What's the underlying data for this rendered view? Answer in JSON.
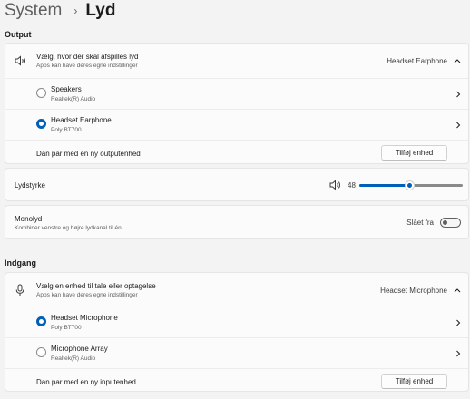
{
  "breadcrumb": {
    "parent": "System",
    "separator": "›",
    "current": "Lyd"
  },
  "output": {
    "section_title": "Output",
    "chooser": {
      "title": "Vælg, hvor der skal afspilles lyd",
      "subtitle": "Apps kan have deres egne indstillinger",
      "selected": "Headset Earphone",
      "icon": "speaker-icon"
    },
    "devices": [
      {
        "name": "Speakers",
        "driver": "Realtek(R) Audio",
        "selected": false
      },
      {
        "name": "Headset Earphone",
        "driver": "Poly BT700",
        "selected": true
      }
    ],
    "pair": {
      "label": "Dan par med en ny outputenhed",
      "button": "Tilføj enhed"
    }
  },
  "volume": {
    "label": "Lydstyrke",
    "value": "48",
    "level": 0.48,
    "icon": "volume-icon"
  },
  "mono": {
    "title": "Monolyd",
    "subtitle": "Kombiner venstre og højre lydkanal til én",
    "state_label": "Slået fra",
    "on": false
  },
  "input": {
    "section_title": "Indgang",
    "chooser": {
      "title": "Vælg en enhed til tale eller optagelse",
      "subtitle": "Apps kan have deres egne indstillinger",
      "selected": "Headset Microphone",
      "icon": "microphone-icon"
    },
    "devices": [
      {
        "name": "Headset Microphone",
        "driver": "Poly BT700",
        "selected": true
      },
      {
        "name": "Microphone Array",
        "driver": "Realtek(R) Audio",
        "selected": false
      }
    ],
    "pair": {
      "label": "Dan par med en ny inputenhed",
      "button": "Tilføj enhed"
    }
  },
  "colors": {
    "accent": "#005fb8",
    "background": "#f3f3f3",
    "card": "#fbfbfb"
  }
}
